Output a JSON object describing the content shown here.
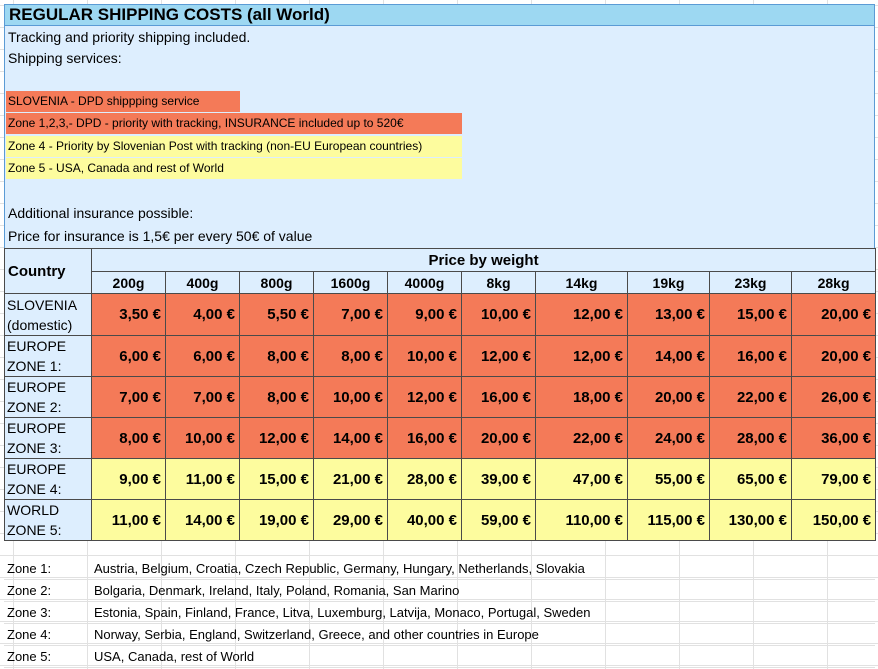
{
  "header": {
    "title": "REGULAR SHIPPING COSTS (all World)"
  },
  "info": {
    "line1": "Tracking and priority shipping included.",
    "line2": "Shipping services:",
    "services": [
      {
        "text": "SLOVENIA - DPD shippping service",
        "color": "#f47a58"
      },
      {
        "text": "Zone 1,2,3,- DPD - priority with tracking, INSURANCE included up to 520€",
        "color": "#f47a58"
      },
      {
        "text": "Zone 4 - Priority by Slovenian Post with tracking (non-EU European countries)",
        "color": "#fdfc9e"
      },
      {
        "text": "Zone 5 - USA, Canada and rest of World",
        "color": "#fdfc9e"
      }
    ],
    "insurance1": "Additional insurance possible:",
    "insurance2": "Price for insurance is 1,5€ per every 50€ of value"
  },
  "table": {
    "country_header": "Country",
    "price_header": "Price by weight",
    "weights": [
      "200g",
      "400g",
      "800g",
      "1600g",
      "4000g",
      "8kg",
      "14kg",
      "19kg",
      "23kg",
      "28kg"
    ],
    "rows": [
      {
        "label_1": "SLOVENIA",
        "label_2": "(domestic)",
        "prices": [
          "3,50 €",
          "4,00 €",
          "5,50 €",
          "7,00 €",
          "9,00 €",
          "10,00 €",
          "12,00 €",
          "13,00 €",
          "15,00 €",
          "20,00 €"
        ]
      },
      {
        "label_1": "EUROPE",
        "label_2": "ZONE 1:",
        "prices": [
          "6,00 €",
          "6,00 €",
          "8,00 €",
          "8,00 €",
          "10,00 €",
          "12,00 €",
          "12,00 €",
          "14,00 €",
          "16,00 €",
          "20,00 €"
        ]
      },
      {
        "label_1": "EUROPE",
        "label_2": "ZONE 2:",
        "prices": [
          "7,00 €",
          "7,00 €",
          "8,00 €",
          "10,00 €",
          "12,00 €",
          "16,00 €",
          "18,00 €",
          "20,00 €",
          "22,00 €",
          "26,00 €"
        ]
      },
      {
        "label_1": "EUROPE",
        "label_2": "ZONE 3:",
        "prices": [
          "8,00 €",
          "10,00 €",
          "12,00 €",
          "14,00 €",
          "16,00 €",
          "20,00 €",
          "22,00 €",
          "24,00 €",
          "28,00 €",
          "36,00 €"
        ]
      },
      {
        "label_1": "EUROPE",
        "label_2": "ZONE 4:",
        "prices": [
          "9,00 €",
          "11,00 €",
          "15,00 €",
          "21,00 €",
          "28,00 €",
          "39,00 €",
          "47,00 €",
          "55,00 €",
          "65,00 €",
          "79,00 €"
        ]
      },
      {
        "label_1": "WORLD",
        "label_2": "ZONE 5:",
        "prices": [
          "11,00 €",
          "14,00 €",
          "19,00 €",
          "29,00 €",
          "40,00 €",
          "59,00 €",
          "110,00 €",
          "115,00 €",
          "130,00 €",
          "150,00 €"
        ]
      }
    ]
  },
  "zones": [
    {
      "label": "Zone 1:",
      "countries": "Austria, Belgium, Croatia, Czech Republic, Germany, Hungary, Netherlands, Slovakia"
    },
    {
      "label": "Zone 2:",
      "countries": "Bolgaria, Denmark, Ireland, Italy, Poland, Romania, San Marino"
    },
    {
      "label": "Zone 3:",
      "countries": "Estonia, Spain, Finland, France, Litva, Luxemburg, Latvija, Monaco, Portugal, Sweden"
    },
    {
      "label": "Zone 4:",
      "countries": "Norway, Serbia, England, Switzerland, Greece, and other countries in Europe"
    },
    {
      "label": "Zone 5:",
      "countries": "USA, Canada, rest of World"
    }
  ],
  "colors": {
    "title_bg": "#9dd8f2",
    "info_bg": "#ddeefe",
    "red_zone": "#f47a58",
    "yellow_zone": "#fdfc9e"
  }
}
